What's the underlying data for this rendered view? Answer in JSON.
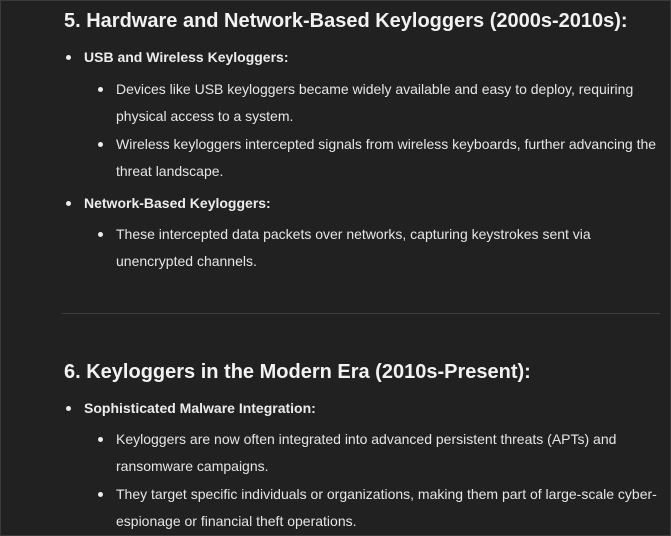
{
  "section5": {
    "heading": "5. Hardware and Network-Based Keyloggers (2000s-2010s):",
    "groups": [
      {
        "label": "USB and Wireless Keyloggers:",
        "items": [
          "Devices like USB keyloggers became widely available and easy to deploy, requiring physical access to a system.",
          "Wireless keyloggers intercepted signals from wireless keyboards, further advancing the threat landscape."
        ]
      },
      {
        "label": "Network-Based Keyloggers:",
        "items": [
          "These intercepted data packets over networks, capturing keystrokes sent via unencrypted channels."
        ]
      }
    ]
  },
  "section6": {
    "heading": "6. Keyloggers in the Modern Era (2010s-Present):",
    "groups": [
      {
        "label": "Sophisticated Malware Integration:",
        "items": [
          "Keyloggers are now often integrated into advanced persistent threats (APTs) and ransomware campaigns.",
          "They target specific individuals or organizations, making them part of large-scale cyber-espionage or financial theft operations."
        ]
      }
    ]
  }
}
